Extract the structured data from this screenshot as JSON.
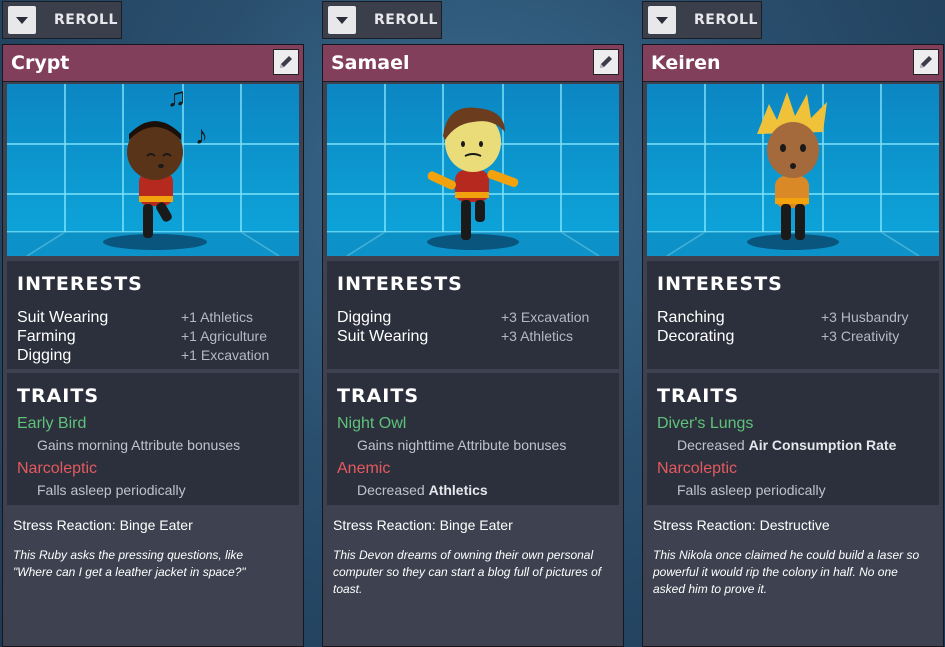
{
  "cards": [
    {
      "reroll_label": "REROLL",
      "name": "Crypt",
      "interests_title": "INTERESTS",
      "interests": [
        {
          "name": "Suit Wearing",
          "bonus": "+1 Athletics"
        },
        {
          "name": "Farming",
          "bonus": "+1 Agriculture"
        },
        {
          "name": "Digging",
          "bonus": "+1 Excavation"
        }
      ],
      "traits_title": "TRAITS",
      "traits": [
        {
          "name": "Early Bird",
          "kind": "good",
          "desc_prefix": "Gains morning Attribute bonuses",
          "desc_bold": ""
        },
        {
          "name": "Narcoleptic",
          "kind": "bad",
          "desc_prefix": "Falls asleep periodically",
          "desc_bold": ""
        }
      ],
      "stress": "Stress Reaction: Binge Eater",
      "bio": "This Ruby asks the pressing questions, like \"Where can I get a leather jacket in space?\""
    },
    {
      "reroll_label": "REROLL",
      "name": "Samael",
      "interests_title": "INTERESTS",
      "interests": [
        {
          "name": "Digging",
          "bonus": "+3 Excavation"
        },
        {
          "name": "Suit Wearing",
          "bonus": "+3 Athletics"
        }
      ],
      "traits_title": "TRAITS",
      "traits": [
        {
          "name": "Night Owl",
          "kind": "good",
          "desc_prefix": "Gains nighttime Attribute bonuses",
          "desc_bold": ""
        },
        {
          "name": "Anemic",
          "kind": "bad",
          "desc_prefix": "Decreased ",
          "desc_bold": "Athletics"
        }
      ],
      "stress": "Stress Reaction: Binge Eater",
      "bio": "This Devon dreams of owning their own personal computer so they can start a blog full of pictures of toast."
    },
    {
      "reroll_label": "REROLL",
      "name": "Keiren",
      "interests_title": "INTERESTS",
      "interests": [
        {
          "name": "Ranching",
          "bonus": "+3 Husbandry"
        },
        {
          "name": "Decorating",
          "bonus": "+3 Creativity"
        }
      ],
      "traits_title": "TRAITS",
      "traits": [
        {
          "name": "Diver's Lungs",
          "kind": "good",
          "desc_prefix": "Decreased ",
          "desc_bold": "Air Consumption Rate"
        },
        {
          "name": "Narcoleptic",
          "kind": "bad",
          "desc_prefix": "Falls asleep periodically",
          "desc_bold": ""
        }
      ],
      "stress": "Stress Reaction: Destructive",
      "bio": "This Nikola once claimed he could build a laser so powerful it would rip the colony in half. No one asked him to prove it."
    }
  ],
  "icons": {
    "reroll_dropdown": "chevron-down-icon",
    "rename": "pencil-icon"
  },
  "colors": {
    "title_bar": "#823f5c",
    "good_trait": "#5fc27a",
    "bad_trait": "#e45a5e",
    "panel": "#2c303c"
  }
}
